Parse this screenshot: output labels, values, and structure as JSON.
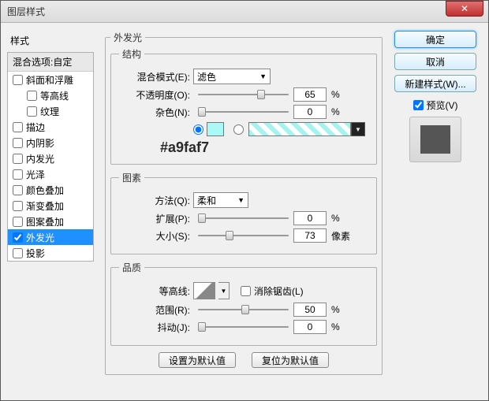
{
  "title": "图层样式",
  "left": {
    "title": "样式",
    "header": "混合选项:自定",
    "items": [
      {
        "label": "斜面和浮雕",
        "checked": false,
        "indent": false
      },
      {
        "label": "等高线",
        "checked": false,
        "indent": true
      },
      {
        "label": "纹理",
        "checked": false,
        "indent": true
      },
      {
        "label": "描边",
        "checked": false,
        "indent": false
      },
      {
        "label": "内阴影",
        "checked": false,
        "indent": false
      },
      {
        "label": "内发光",
        "checked": false,
        "indent": false
      },
      {
        "label": "光泽",
        "checked": false,
        "indent": false
      },
      {
        "label": "颜色叠加",
        "checked": false,
        "indent": false
      },
      {
        "label": "渐变叠加",
        "checked": false,
        "indent": false
      },
      {
        "label": "图案叠加",
        "checked": false,
        "indent": false
      },
      {
        "label": "外发光",
        "checked": true,
        "indent": false,
        "selected": true
      },
      {
        "label": "投影",
        "checked": false,
        "indent": false
      }
    ]
  },
  "center": {
    "section_title": "外发光",
    "structure": {
      "legend": "结构",
      "blend_label": "混合模式(E):",
      "blend_value": "滤色",
      "opacity_label": "不透明度(O):",
      "opacity_value": "65",
      "opacity_unit": "%",
      "noise_label": "杂色(N):",
      "noise_value": "0",
      "noise_unit": "%",
      "color_hex": "#a9faf7"
    },
    "elements": {
      "legend": "图素",
      "method_label": "方法(Q):",
      "method_value": "柔和",
      "spread_label": "扩展(P):",
      "spread_value": "0",
      "spread_unit": "%",
      "size_label": "大小(S):",
      "size_value": "73",
      "size_unit": "像素"
    },
    "quality": {
      "legend": "品质",
      "contour_label": "等高线:",
      "antialias_label": "消除锯齿(L)",
      "range_label": "范围(R):",
      "range_value": "50",
      "range_unit": "%",
      "jitter_label": "抖动(J):",
      "jitter_value": "0",
      "jitter_unit": "%"
    },
    "defaults": {
      "set": "设置为默认值",
      "reset": "复位为默认值"
    }
  },
  "right": {
    "ok": "确定",
    "cancel": "取消",
    "newstyle": "新建样式(W)...",
    "preview_label": "预览(V)"
  }
}
